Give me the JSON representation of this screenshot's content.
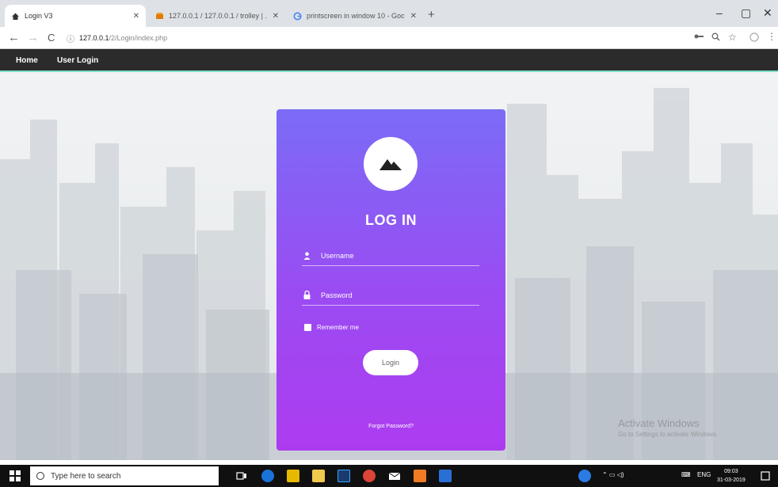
{
  "browser": {
    "tabs": [
      {
        "title": "Login V3",
        "icon": "house-icon",
        "active": true
      },
      {
        "title": "127.0.0.1 / 127.0.0.1 / trolley | ...",
        "icon": "database-icon",
        "active": false
      },
      {
        "title": "printscreen in window 10 - Goo...",
        "icon": "google-icon",
        "active": false
      }
    ],
    "new_tab_label": "+",
    "window_controls": {
      "minimize": "–",
      "maximize": "▢",
      "close": "✕"
    },
    "nav": {
      "back": "←",
      "forward": "→",
      "reload": "C"
    },
    "address": {
      "host": "127.0.0.1",
      "path": "/2/Login/index.php"
    }
  },
  "site_nav": {
    "items": [
      "Home",
      "User Login"
    ]
  },
  "login": {
    "title": "LOG IN",
    "username_placeholder": "Username",
    "password_placeholder": "Password",
    "remember_label": "Remember me",
    "button_label": "Login",
    "forgot_label": "Forgot Password?"
  },
  "watermark": {
    "line1": "Activate Windows",
    "line2": "Go to Settings to activate Windows."
  },
  "taskbar": {
    "search_placeholder": "Type here to search",
    "lang": "ENG",
    "time": "09:03",
    "date": "31-03-2019"
  },
  "colors": {
    "card_top": "#7b6cf6",
    "card_bottom": "#ad3cf0",
    "accent_line": "#7adfc8",
    "nav_bg": "#2b2b2b"
  }
}
